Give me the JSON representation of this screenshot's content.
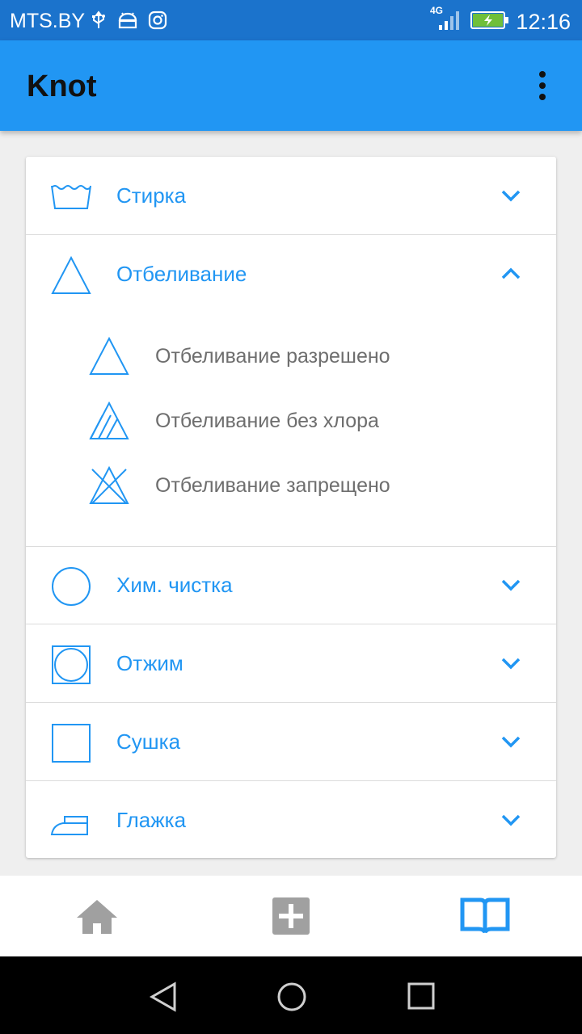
{
  "status_bar": {
    "carrier": "MTS.BY",
    "network": "4G",
    "time": "12:16",
    "icons": [
      "usb-icon",
      "android-icon",
      "instagram-icon",
      "signal-icon",
      "battery-charging-icon"
    ]
  },
  "app_bar": {
    "title": "Knot",
    "menu_icon": "more-vert-icon"
  },
  "categories": [
    {
      "label": "Стирка",
      "icon": "washing-tub-icon",
      "expanded": false
    },
    {
      "label": "Отбеливание",
      "icon": "bleach-triangle-icon",
      "expanded": true,
      "items": [
        {
          "label": "Отбеливание разрешено",
          "icon": "bleach-allowed-icon"
        },
        {
          "label": "Отбеливание без хлора",
          "icon": "bleach-non-chlorine-icon"
        },
        {
          "label": "Отбеливание запрещено",
          "icon": "bleach-forbidden-icon"
        }
      ]
    },
    {
      "label": "Хим. чистка",
      "icon": "dry-clean-circle-icon",
      "expanded": false
    },
    {
      "label": "Отжим",
      "icon": "tumble-dry-icon",
      "expanded": false
    },
    {
      "label": "Сушка",
      "icon": "drying-square-icon",
      "expanded": false
    },
    {
      "label": "Глажка",
      "icon": "iron-icon",
      "expanded": false
    }
  ],
  "bottom_nav": {
    "items": [
      {
        "icon": "home-icon",
        "active": false
      },
      {
        "icon": "add-box-icon",
        "active": false
      },
      {
        "icon": "book-icon",
        "active": true
      }
    ]
  },
  "colors": {
    "primary": "#2196f3",
    "status_bar": "#1b73cc",
    "inactive_icon": "#a0a0a0",
    "sub_text": "#6e6e6e"
  }
}
